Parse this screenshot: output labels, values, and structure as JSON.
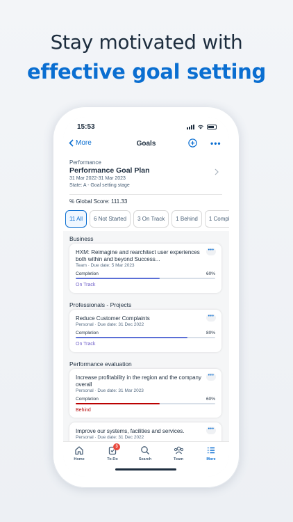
{
  "headline": {
    "line1": "Stay motivated with",
    "line2": "effective goal setting"
  },
  "status_bar": {
    "time": "15:53"
  },
  "nav": {
    "back_label": "More",
    "title": "Goals",
    "more_label": "•••"
  },
  "header": {
    "category": "Performance",
    "title": "Performance Goal Plan",
    "dates": "31 Mar 2022-31 Mar 2023",
    "state": "State: A - Goal setting stage",
    "score": "% Global Score: 111.33"
  },
  "filters": [
    "11 All",
    "6 Not Started",
    "3 On Track",
    "1 Behind",
    "1 Compl"
  ],
  "sections": [
    {
      "title": "Business",
      "goal": {
        "title": "HXM: Reimagine and rearchitect user experiences both within and beyond Success...",
        "subtitle": "Team · Due date: 5 Mar 2023",
        "completion_label": "Completion",
        "completion_text": "60%",
        "completion": 60,
        "status": "On Track"
      }
    },
    {
      "title": "Professionals - Projects",
      "goal": {
        "title": "Reduce Customer Complaints",
        "subtitle": "Personal · Due date: 31 Dec 2022",
        "completion_label": "Completion",
        "completion_text": "80%",
        "completion": 80,
        "status": "On Track"
      }
    },
    {
      "title": "Performance evaluation",
      "goal": {
        "title": "Increase profitability in the region and the company overall",
        "subtitle": "Personal · Due date: 31 Mar 2023",
        "completion_label": "Completion",
        "completion_text": "60%",
        "completion": 60,
        "status": "Behind"
      }
    }
  ],
  "partial_goal": {
    "title": "Improve our systems, facilities and services.",
    "subtitle": "Personal · Due date: 31 Dec 2022"
  },
  "card_menu": "•••",
  "colors": {
    "accent": "#0a6ed1",
    "on_track": "#5b6fd6",
    "on_track_text": "#6e5ec9",
    "behind": "#bb0000",
    "behind_text": "#b80a0a"
  },
  "tabbar": {
    "tabs": [
      {
        "label": "Home",
        "icon": "home-icon"
      },
      {
        "label": "To-Do",
        "icon": "todo-icon",
        "badge": "3"
      },
      {
        "label": "Search",
        "icon": "search-icon"
      },
      {
        "label": "Team",
        "icon": "team-icon"
      },
      {
        "label": "More",
        "icon": "more-list-icon",
        "active": true
      }
    ]
  }
}
